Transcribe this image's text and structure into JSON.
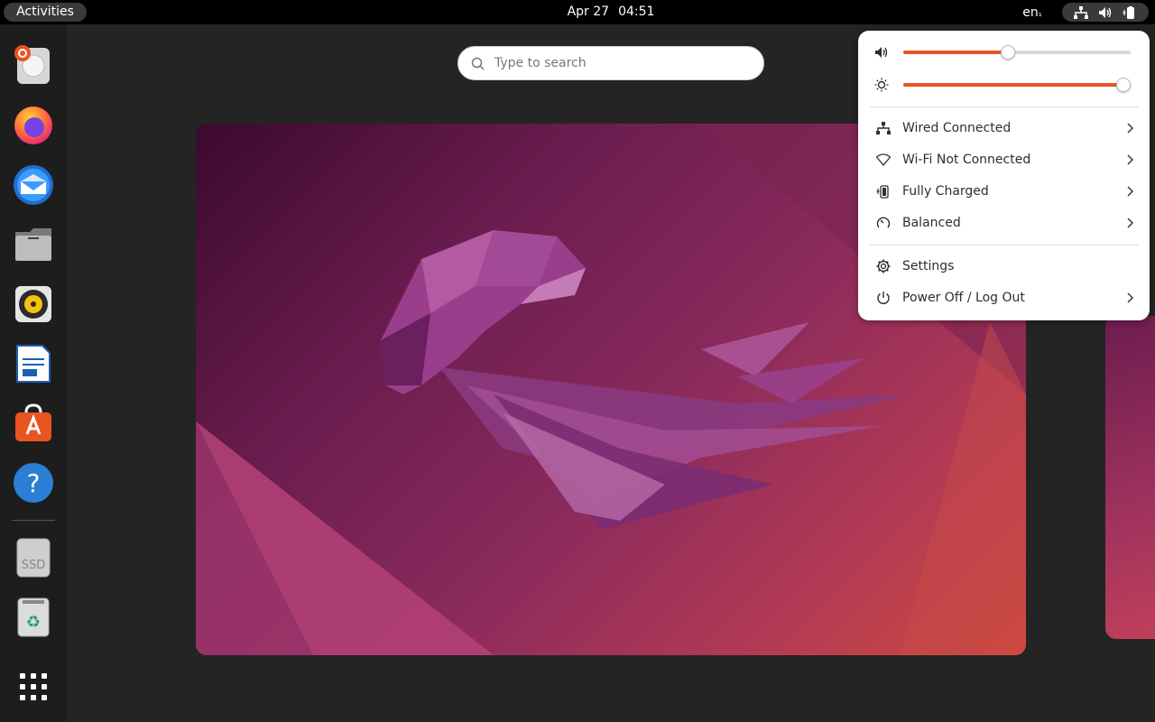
{
  "topbar": {
    "activities": "Activities",
    "date": "Apr 27",
    "time": "04:51",
    "language": "en",
    "language_suffix": "₁"
  },
  "dock": {
    "apps": [
      {
        "name": "installer-icon"
      },
      {
        "name": "firefox-icon"
      },
      {
        "name": "thunderbird-icon"
      },
      {
        "name": "files-icon"
      },
      {
        "name": "rhythmbox-icon"
      },
      {
        "name": "libreoffice-writer-icon"
      },
      {
        "name": "app-center-icon"
      },
      {
        "name": "help-icon"
      },
      {
        "name": "ssd-drive-icon",
        "label": "SSD"
      },
      {
        "name": "trash-icon"
      },
      {
        "name": "show-apps-icon"
      }
    ]
  },
  "search": {
    "placeholder": "Type to search"
  },
  "quick_settings": {
    "volume_level": 0.46,
    "brightness_level": 0.97,
    "accent_color": "#e95420",
    "items": [
      {
        "label": "Wired Connected",
        "icon": "wired-network-icon"
      },
      {
        "label": "Wi-Fi Not Connected",
        "icon": "wifi-icon"
      },
      {
        "label": "Fully Charged",
        "icon": "battery-icon"
      },
      {
        "label": "Balanced",
        "icon": "power-profile-icon"
      }
    ],
    "settings_label": "Settings",
    "power_label": "Power Off / Log Out"
  }
}
